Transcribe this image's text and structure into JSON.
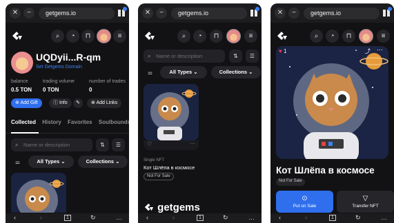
{
  "browser": {
    "url": "getgems.io",
    "close": "✕",
    "menu": "−"
  },
  "site": {
    "logo_letter": "G",
    "brand": "getgems"
  },
  "header_icons": {
    "search": "⌕",
    "bell": "🔔",
    "cart": "🛒",
    "menu": "≡"
  },
  "profile": {
    "name": "UQDyii...R-qm",
    "set_domain": "Set Getgems Domain",
    "stats": [
      {
        "label": "balance",
        "value": "0.5 TON"
      },
      {
        "label": "trading volume",
        "value": "0 TON"
      },
      {
        "label": "number of trades",
        "value": "0"
      }
    ],
    "actions": {
      "add_gift": "Add Gift",
      "info": "Info",
      "add_links": "Add Links"
    },
    "tabs": [
      "Collected",
      "History",
      "Favorites",
      "Soulbounds"
    ]
  },
  "filters": {
    "search_placeholder": "Name or description",
    "all_types": "All Types",
    "collections": "Collections"
  },
  "nft": {
    "collection": "Single NFT",
    "name": "Кот Шлёпа в космосе",
    "status": "Not For Sale",
    "like_count": "1",
    "put_on_sale": "Put on Sale",
    "transfer": "Transfer NFT"
  },
  "bottom_nav": {
    "back": "‹",
    "forward": "›",
    "tabs": "1",
    "reload": "↻",
    "more": "…"
  },
  "colors": {
    "background": "#121214",
    "accent": "#2f6fed",
    "link": "#3b82f6"
  }
}
